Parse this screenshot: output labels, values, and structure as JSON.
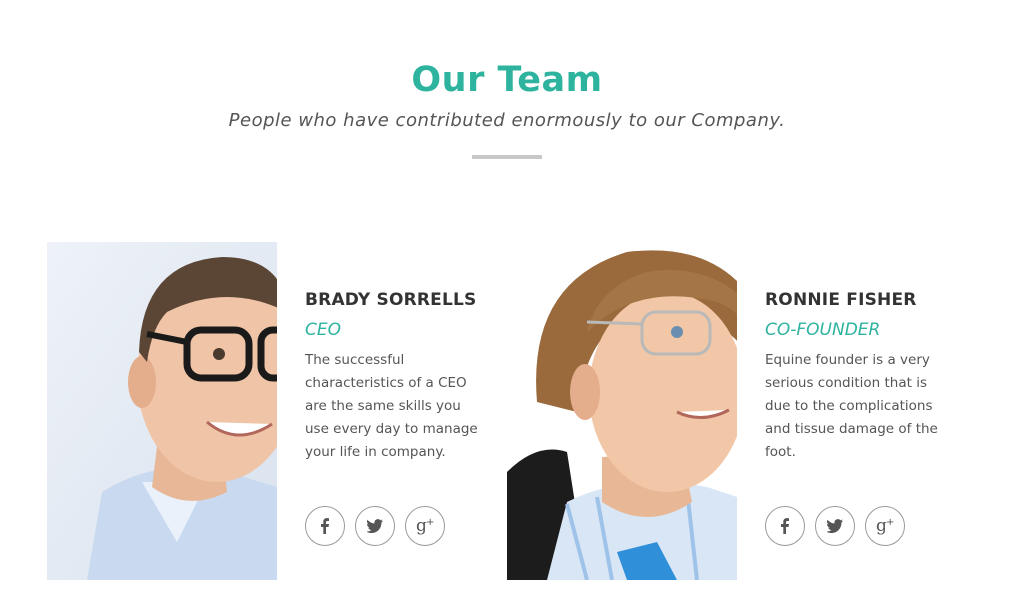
{
  "section": {
    "title": "Our Team",
    "subtitle": "People who have contributed enormously to our Company."
  },
  "colors": {
    "accent": "#2db39e",
    "divider": "#c8c8c8",
    "text": "#333333"
  },
  "members": [
    {
      "name": "BRADY SORRELLS",
      "role": "CEO",
      "bio": "The successful characteristics of a CEO are the same skills you use every day to manage your life in company.",
      "socials": [
        "facebook-icon",
        "twitter-icon",
        "google-plus-icon"
      ]
    },
    {
      "name": "RONNIE FISHER",
      "role": "CO-FOUNDER",
      "bio": "Equine founder is a very serious condition that is due to the complications and tissue damage of the foot.",
      "socials": [
        "facebook-icon",
        "twitter-icon",
        "google-plus-icon"
      ]
    }
  ]
}
